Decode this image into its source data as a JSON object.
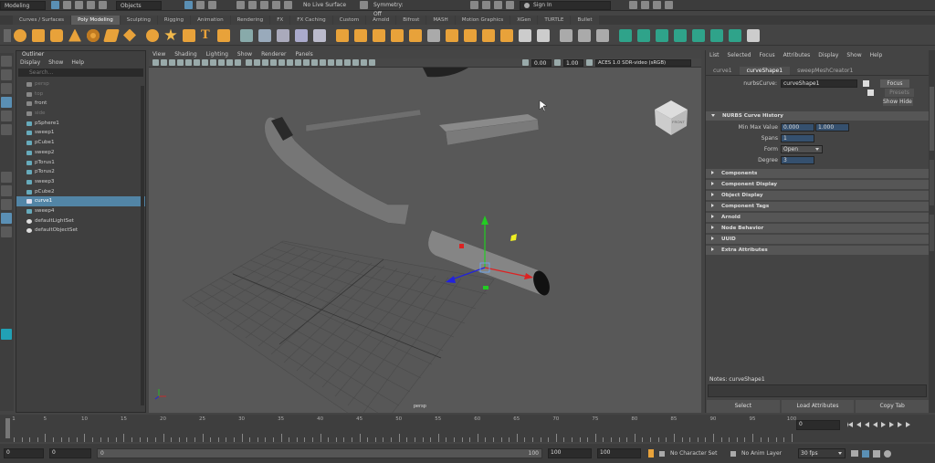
{
  "topbar": {
    "mode": "Modeling",
    "selection_mode": "Objects",
    "live_surface": "No Live Surface",
    "symmetry": "Symmetry: Off",
    "sign_in": "Sign In"
  },
  "shelf_tabs": [
    "Curves / Surfaces",
    "Poly Modeling",
    "Sculpting",
    "Rigging",
    "Animation",
    "Rendering",
    "FX",
    "FX Caching",
    "Custom",
    "Arnold",
    "Bifrost",
    "MASH",
    "Motion Graphics",
    "XGen",
    "TURTLE",
    "Bullet"
  ],
  "shelf_active": "Poly Modeling",
  "outliner": {
    "title": "Outliner",
    "menu": [
      "Display",
      "Show",
      "Help"
    ],
    "search_placeholder": "Search...",
    "items": [
      {
        "label": "persp",
        "dim": true
      },
      {
        "label": "top",
        "dim": true
      },
      {
        "label": "front",
        "dim": false
      },
      {
        "label": "side",
        "dim": true
      },
      {
        "label": "pSphere1",
        "dim": false
      },
      {
        "label": "sweep1",
        "dim": false
      },
      {
        "label": "pCube1",
        "dim": false
      },
      {
        "label": "sweep2",
        "dim": false
      },
      {
        "label": "pTorus1",
        "dim": false
      },
      {
        "label": "pTorus2",
        "dim": false
      },
      {
        "label": "sweep3",
        "dim": false
      },
      {
        "label": "pCube2",
        "dim": false
      },
      {
        "label": "curve1",
        "dim": false,
        "selected": true
      },
      {
        "label": "sweep4",
        "dim": false
      },
      {
        "label": "defaultLightSet",
        "dim": false
      },
      {
        "label": "defaultObjectSet",
        "dim": false
      }
    ]
  },
  "viewport": {
    "menu": [
      "View",
      "Shading",
      "Lighting",
      "Show",
      "Renderer",
      "Panels"
    ],
    "gamma_field": "0.00",
    "exposure_field": "1.00",
    "color_space": "ACES 1.0 SDR-video (sRGB)",
    "camera_label": "persp",
    "viewcube_label": "FRONT"
  },
  "attribute_editor": {
    "menu": [
      "List",
      "Selected",
      "Focus",
      "Attributes",
      "Display",
      "Show",
      "Help"
    ],
    "tabs": [
      "curve1",
      "curveShape1",
      "sweepMeshCreator1"
    ],
    "active_tab": "curveShape1",
    "node_type_label": "nurbsCurve:",
    "node_name": "curveShape1",
    "focus_button": "Focus",
    "presets_button": "Presets",
    "show_button": "Show",
    "hide_button": "Hide",
    "section_open": "NURBS Curve History",
    "min_max_label": "Min Max Value",
    "min_value": "0.000",
    "max_value": "1.000",
    "spans_label": "Spans",
    "spans_value": "1",
    "form_label": "Form",
    "form_value": "Open",
    "degree_label": "Degree",
    "degree_value": "3",
    "collapsed_sections": [
      "Components",
      "Component Display",
      "Object Display",
      "Component Tags",
      "Arnold",
      "Node Behavior",
      "UUID",
      "Extra Attributes"
    ],
    "notes_label": "Notes:  curveShape1",
    "select_button": "Select",
    "load_attributes_button": "Load Attributes",
    "copy_tab_button": "Copy Tab"
  },
  "timeline": {
    "ticks": [
      "5",
      "10",
      "15",
      "20",
      "25",
      "30",
      "35",
      "40",
      "45",
      "50",
      "55",
      "60",
      "65",
      "70",
      "75",
      "80",
      "85",
      "90",
      "95",
      "100"
    ],
    "start_tick": "1",
    "current_frame": "0"
  },
  "range": {
    "start": "0",
    "start2": "0",
    "slider_start": "0",
    "slider_end": "100",
    "end": "100",
    "end2": "100",
    "character_set": "No Character Set",
    "anim_layer": "No Anim Layer",
    "fps": "30 fps"
  },
  "colors": {
    "selection_blue": "#5285a6",
    "viewport_bg": "#585858",
    "accent_orange": "#e8a23a",
    "accent_teal": "#2fa38a"
  }
}
